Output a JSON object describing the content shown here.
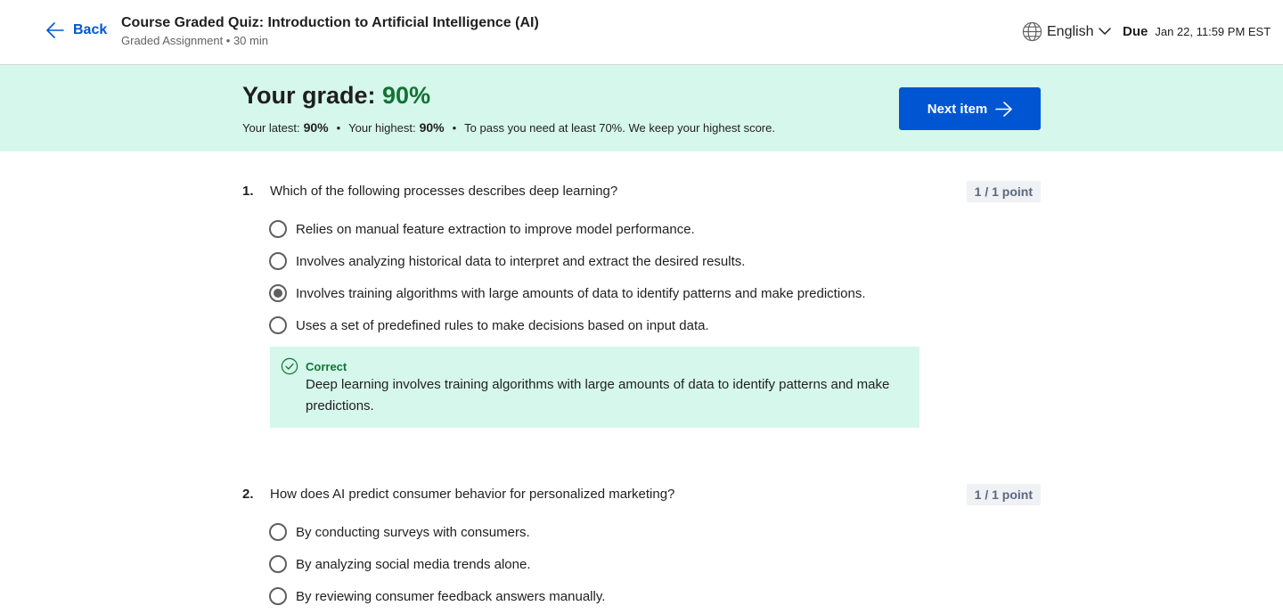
{
  "header": {
    "back_label": "Back",
    "title": "Course Graded Quiz: Introduction to Artificial Intelligence (AI)",
    "subtitle": "Graded Assignment • 30 min",
    "language": "English",
    "due_label": "Due",
    "due_date": "Jan 22, 11:59 PM EST"
  },
  "grade": {
    "label": "Your grade: ",
    "value": "90%",
    "latest_label": "Your latest:",
    "latest_value": "90%",
    "highest_label": "Your highest:",
    "highest_value": "90%",
    "separator": "•",
    "pass_note": "To pass you need at least 70%. We keep your highest score.",
    "next_label": "Next item"
  },
  "questions": [
    {
      "number": "1.",
      "text": "Which of the following processes describes deep learning?",
      "points": "1 / 1 point",
      "options": [
        "Relies on manual feature extraction to improve model performance.",
        "Involves analyzing historical data to interpret and extract the desired results.",
        "Involves training algorithms with large amounts of data to identify patterns and make predictions.",
        "Uses a set of predefined rules to make decisions based on input data."
      ],
      "selected_index": 2,
      "feedback": {
        "status": "Correct",
        "text": "Deep learning involves training algorithms with large amounts of data to identify patterns and make predictions."
      }
    },
    {
      "number": "2.",
      "text": "How does AI predict consumer behavior for personalized marketing?",
      "points": "1 / 1 point",
      "options": [
        "By conducting surveys with consumers.",
        "By analyzing social media trends alone.",
        "By reviewing consumer feedback answers manually."
      ]
    }
  ],
  "icons": {
    "back": "arrow-left-icon",
    "language": "globe-icon",
    "dropdown": "chevron-down-icon",
    "next": "arrow-right-icon",
    "feedback": "check-circle-icon"
  },
  "colors": {
    "accent_blue": "#0056d2",
    "success_green": "#137333",
    "banner_bg": "#d6f7ec",
    "points_bg": "#f0f1f4"
  }
}
